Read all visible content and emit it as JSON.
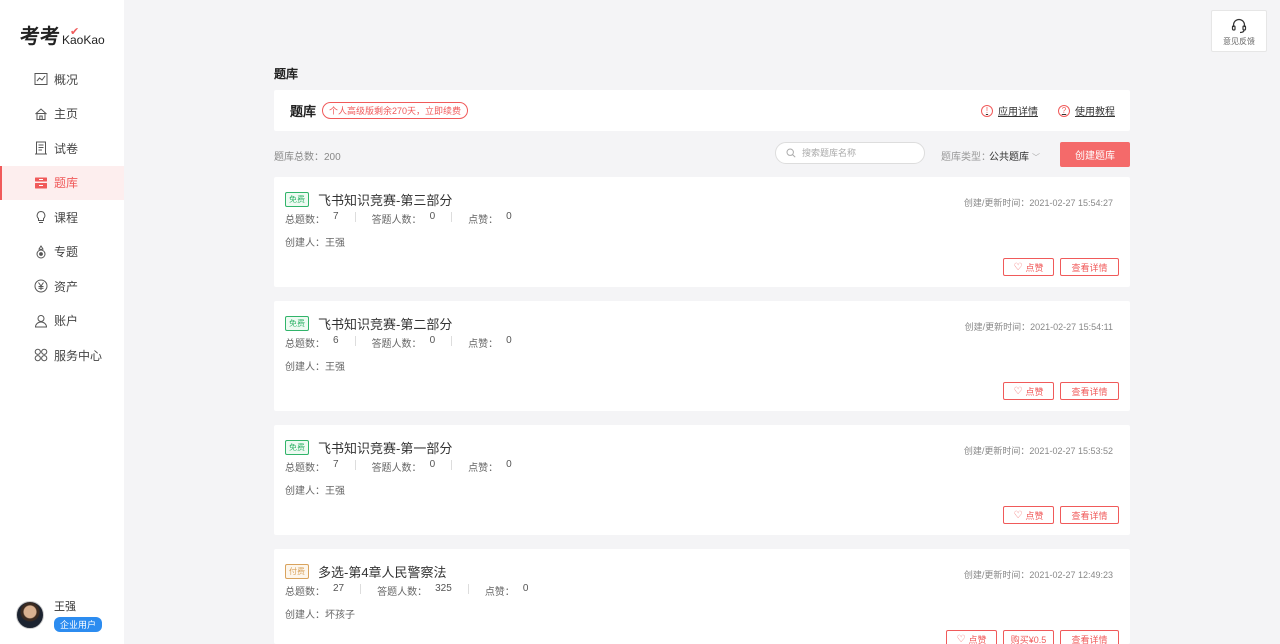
{
  "sidebar": {
    "logo_cn": "考考",
    "logo_en": "KaoKao",
    "items": [
      {
        "label": "概况",
        "icon": "chart-icon"
      },
      {
        "label": "主页",
        "icon": "home-icon"
      },
      {
        "label": "试卷",
        "icon": "document-icon"
      },
      {
        "label": "题库",
        "icon": "database-icon",
        "active": true
      },
      {
        "label": "课程",
        "icon": "lightbulb-icon"
      },
      {
        "label": "专题",
        "icon": "topic-icon"
      },
      {
        "label": "资产",
        "icon": "yen-icon"
      },
      {
        "label": "账户",
        "icon": "user-icon"
      },
      {
        "label": "服务中心",
        "icon": "grid-icon"
      }
    ],
    "user": {
      "name": "王强",
      "badge": "企业用户"
    }
  },
  "feedback": {
    "label": "意见反馈"
  },
  "page_title": "题库",
  "header_card": {
    "title": "题库",
    "tag": "个人高级版剩余270天，立即续费",
    "link_detail": "应用详情",
    "link_tutorial": "使用教程"
  },
  "toolbar": {
    "count": "题库总数：200",
    "search_placeholder": "搜索题库名称",
    "type_label": "题库类型：",
    "type_value": "公共题库",
    "create_label": "创建题库"
  },
  "cards": [
    {
      "tag": "免费",
      "title": "飞书知识竞赛-第三部分",
      "time": "创建/更新时间：2021-02-27 15:54:27",
      "total_label": "总题数：",
      "total": "7",
      "answers_label": "答题人数：",
      "answers": "0",
      "likes_label": "点赞：",
      "likes": "0",
      "creator": "创建人：王强",
      "like_btn": "点赞",
      "view_btn": "查看详情"
    },
    {
      "tag": "免费",
      "title": "飞书知识竞赛-第二部分",
      "time": "创建/更新时间：2021-02-27 15:54:11",
      "total_label": "总题数：",
      "total": "6",
      "answers_label": "答题人数：",
      "answers": "0",
      "likes_label": "点赞：",
      "likes": "0",
      "creator": "创建人：王强",
      "like_btn": "点赞",
      "view_btn": "查看详情"
    },
    {
      "tag": "免费",
      "title": "飞书知识竞赛-第一部分",
      "time": "创建/更新时间：2021-02-27 15:53:52",
      "total_label": "总题数：",
      "total": "7",
      "answers_label": "答题人数：",
      "answers": "0",
      "likes_label": "点赞：",
      "likes": "0",
      "creator": "创建人：王强",
      "like_btn": "点赞",
      "view_btn": "查看详情"
    },
    {
      "tag": "付费",
      "title": "多选-第4章人民警察法",
      "time": "创建/更新时间：2021-02-27 12:49:23",
      "total_label": "总题数：",
      "total": "27",
      "answers_label": "答题人数：",
      "answers": "325",
      "likes_label": "点赞：",
      "likes": "0",
      "creator": "创建人：坏孩子",
      "like_btn": "点赞",
      "buy_btn": "购买¥0.5",
      "view_btn": "查看详情"
    }
  ],
  "colors": {
    "accent": "#f05a5a",
    "free": "#31b46a",
    "paid": "#d9a35d",
    "badge": "#2c8cf0"
  }
}
